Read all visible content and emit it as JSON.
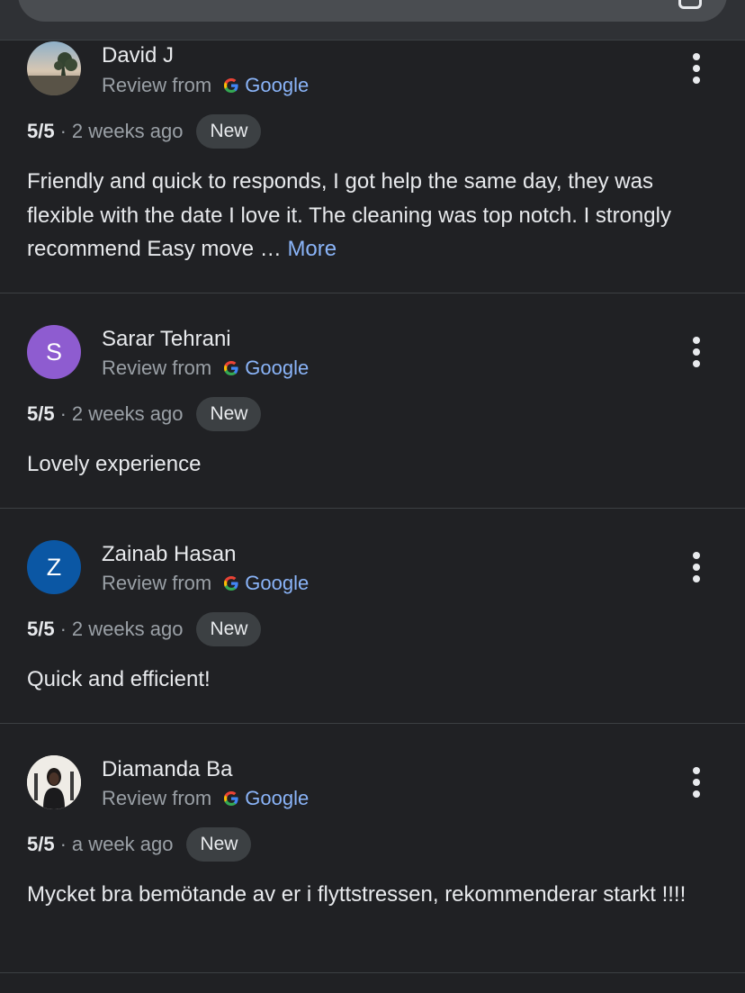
{
  "reviews": [
    {
      "name": "David J",
      "source_prefix": "Review from",
      "provider": "Google",
      "rating": "5/5",
      "time": "2 weeks ago",
      "badge": "New",
      "text": "Friendly and quick to responds, I got help the same day, they was flexible with the date I love it. The cleaning was top notch. I strongly recommend Easy move …",
      "more": "More",
      "avatar": {
        "type": "photo",
        "subject": "landscape"
      }
    },
    {
      "name": "Sarar Tehrani",
      "source_prefix": "Review from",
      "provider": "Google",
      "rating": "5/5",
      "time": "2 weeks ago",
      "badge": "New",
      "text": "Lovely experience",
      "avatar": {
        "type": "initial",
        "initial": "S",
        "color": "#8e5cd0"
      }
    },
    {
      "name": "Zainab Hasan",
      "source_prefix": "Review from",
      "provider": "Google",
      "rating": "5/5",
      "time": "2 weeks ago",
      "badge": "New",
      "text": "Quick and efficient!",
      "avatar": {
        "type": "initial",
        "initial": "Z",
        "color": "#0b57a4"
      }
    },
    {
      "name": "Diamanda Ba",
      "source_prefix": "Review from",
      "provider": "Google",
      "rating": "5/5",
      "time": "a week ago",
      "badge": "New",
      "text": "Mycket bra bemötande av er i flyttstressen, rekommenderar starkt !!!!",
      "avatar": {
        "type": "photo",
        "subject": "portrait"
      }
    }
  ],
  "colors": {
    "background": "#202124",
    "divider": "#3c4043",
    "link": "#8ab4f8",
    "secondary_text": "#9aa0a6",
    "badge_bg": "#3c4043"
  },
  "icons": {
    "provider_logo": "google-g-icon",
    "menu": "more-vert-icon"
  }
}
